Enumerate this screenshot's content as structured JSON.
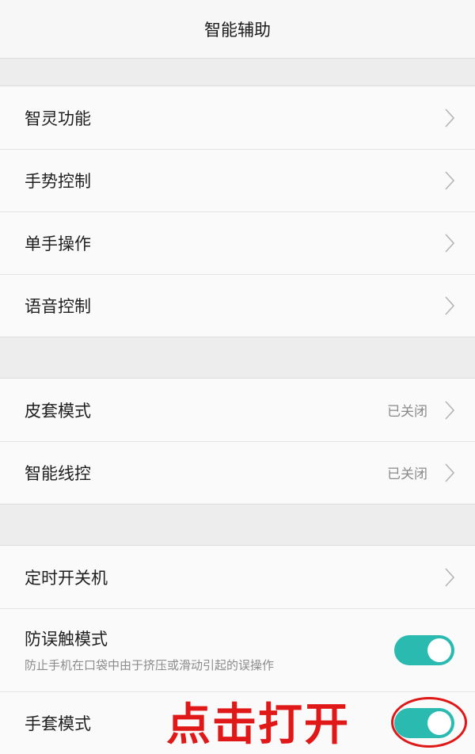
{
  "header": {
    "title": "智能辅助"
  },
  "group1": {
    "items": [
      {
        "label": "智灵功能"
      },
      {
        "label": "手势控制"
      },
      {
        "label": "单手操作"
      },
      {
        "label": "语音控制"
      }
    ]
  },
  "group2": {
    "items": [
      {
        "label": "皮套模式",
        "status": "已关闭"
      },
      {
        "label": "智能线控",
        "status": "已关闭"
      }
    ]
  },
  "group3": {
    "timer": {
      "label": "定时开关机"
    },
    "mistouch": {
      "label": "防误触模式",
      "description": "防止手机在口袋中由于挤压或滑动引起的误操作",
      "enabled": true
    },
    "glove": {
      "label": "手套模式",
      "enabled": true
    }
  },
  "annotation": {
    "text": "点击打开",
    "color": "#e01818"
  },
  "colors": {
    "toggle_on": "#2bbab0",
    "chevron": "#b5b5b5"
  }
}
